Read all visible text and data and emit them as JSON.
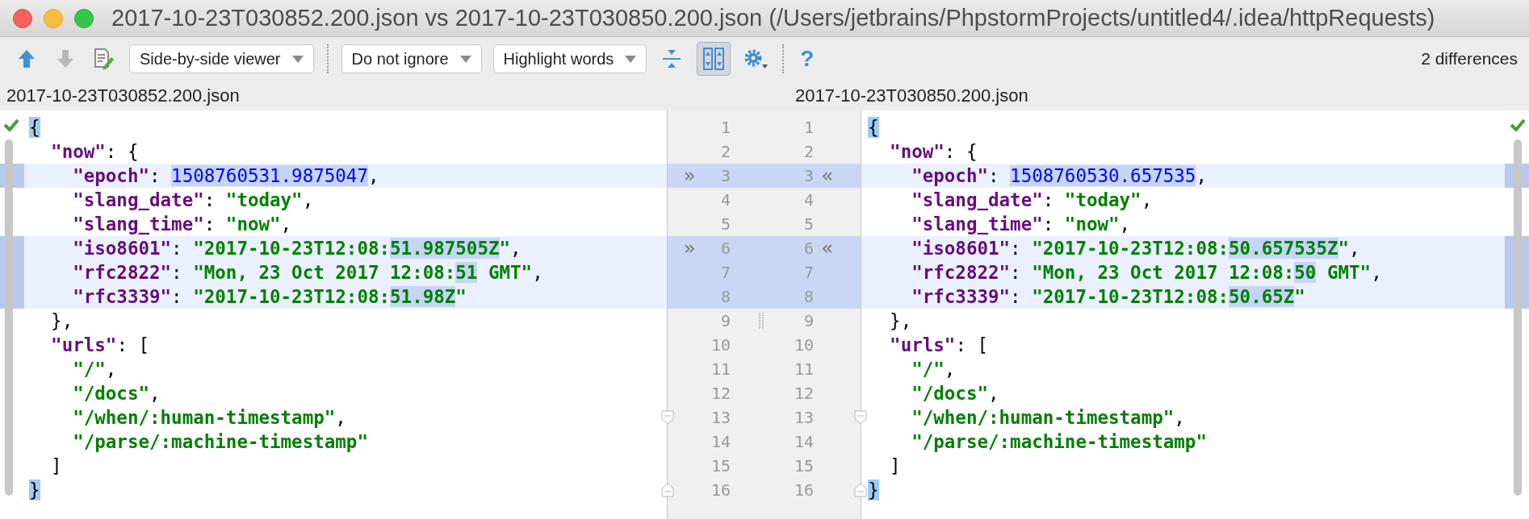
{
  "window": {
    "title": "2017-10-23T030852.200.json vs 2017-10-23T030850.200.json (/Users/jetbrains/PhpstormProjects/untitled4/.idea/httpRequests)"
  },
  "toolbar": {
    "items": [
      {
        "kind": "prev",
        "disabled": false
      },
      {
        "kind": "next",
        "disabled": true
      },
      {
        "kind": "edit",
        "disabled": false
      },
      {
        "kind": "dropdown",
        "label": "Side-by-side viewer"
      },
      {
        "kind": "separator"
      },
      {
        "kind": "dropdown",
        "label": "Do not ignore"
      },
      {
        "kind": "dropdown",
        "label": "Highlight words"
      },
      {
        "kind": "collapse",
        "selected": false
      },
      {
        "kind": "sync",
        "selected": true
      },
      {
        "kind": "gear"
      },
      {
        "kind": "separator"
      },
      {
        "kind": "help",
        "label": "?"
      }
    ],
    "differences": "2 differences"
  },
  "left": {
    "filename": "2017-10-23T030852.200.json",
    "lines": [
      {
        "number": "1",
        "changed": false,
        "tokens": [
          {
            "kind": "punct",
            "text": "{",
            "matched": true
          }
        ]
      },
      {
        "number": "2",
        "changed": false,
        "tokens": [
          {
            "kind": "key",
            "text": "  \"now\""
          },
          {
            "kind": "punct",
            "text": ": {"
          }
        ]
      },
      {
        "number": "3",
        "changed": true,
        "arrow": "»",
        "tokens": [
          {
            "kind": "key",
            "text": "    \"epoch\""
          },
          {
            "kind": "punct",
            "text": ": "
          },
          {
            "kind": "number",
            "text": "1508760531.9875047",
            "diff": true
          },
          {
            "kind": "punct",
            "text": ","
          }
        ]
      },
      {
        "number": "4",
        "changed": false,
        "tokens": [
          {
            "kind": "key",
            "text": "    \"slang_date\""
          },
          {
            "kind": "punct",
            "text": ": "
          },
          {
            "kind": "string",
            "text": "\"today\""
          },
          {
            "kind": "punct",
            "text": ","
          }
        ]
      },
      {
        "number": "5",
        "changed": false,
        "tokens": [
          {
            "kind": "key",
            "text": "    \"slang_time\""
          },
          {
            "kind": "punct",
            "text": ": "
          },
          {
            "kind": "string",
            "text": "\"now\""
          },
          {
            "kind": "punct",
            "text": ","
          }
        ]
      },
      {
        "number": "6",
        "changed": true,
        "arrow": "»",
        "tokens": [
          {
            "kind": "key",
            "text": "    \"iso8601\""
          },
          {
            "kind": "punct",
            "text": ": "
          },
          {
            "kind": "string",
            "text": "\"2017-10-23T12:08:"
          },
          {
            "kind": "string",
            "text": "51.987505Z",
            "diff": true
          },
          {
            "kind": "string",
            "text": "\""
          },
          {
            "kind": "punct",
            "text": ","
          }
        ]
      },
      {
        "number": "7",
        "changed": true,
        "tokens": [
          {
            "kind": "key",
            "text": "    \"rfc2822\""
          },
          {
            "kind": "punct",
            "text": ": "
          },
          {
            "kind": "string",
            "text": "\"Mon, 23 Oct 2017 12:08:"
          },
          {
            "kind": "string",
            "text": "51",
            "diff": true
          },
          {
            "kind": "string",
            "text": " GMT\""
          },
          {
            "kind": "punct",
            "text": ","
          }
        ]
      },
      {
        "number": "8",
        "changed": true,
        "tokens": [
          {
            "kind": "key",
            "text": "    \"rfc3339\""
          },
          {
            "kind": "punct",
            "text": ": "
          },
          {
            "kind": "string",
            "text": "\"2017-10-23T12:08:"
          },
          {
            "kind": "string",
            "text": "51.98Z",
            "diff": true
          },
          {
            "kind": "string",
            "text": "\""
          }
        ]
      },
      {
        "number": "9",
        "changed": false,
        "tokens": [
          {
            "kind": "punct",
            "text": "  },"
          }
        ]
      },
      {
        "number": "10",
        "changed": false,
        "tokens": [
          {
            "kind": "key",
            "text": "  \"urls\""
          },
          {
            "kind": "punct",
            "text": ": ["
          }
        ]
      },
      {
        "number": "11",
        "changed": false,
        "tokens": [
          {
            "kind": "string",
            "text": "    \"/\""
          },
          {
            "kind": "punct",
            "text": ","
          }
        ]
      },
      {
        "number": "12",
        "changed": false,
        "tokens": [
          {
            "kind": "string",
            "text": "    \"/docs\""
          },
          {
            "kind": "punct",
            "text": ","
          }
        ]
      },
      {
        "number": "13",
        "changed": false,
        "fold_start": true,
        "tokens": [
          {
            "kind": "string",
            "text": "    \"/when/:human-timestamp\""
          },
          {
            "kind": "punct",
            "text": ","
          }
        ]
      },
      {
        "number": "14",
        "changed": false,
        "tokens": [
          {
            "kind": "string",
            "text": "    \"/parse/:machine-timestamp\""
          }
        ]
      },
      {
        "number": "15",
        "changed": false,
        "tokens": [
          {
            "kind": "punct",
            "text": "  ]"
          }
        ]
      },
      {
        "number": "16",
        "changed": false,
        "fold_end": true,
        "tokens": [
          {
            "kind": "punct",
            "text": "}",
            "matched": true
          }
        ]
      }
    ]
  },
  "right": {
    "filename": "2017-10-23T030850.200.json",
    "lines": [
      {
        "number": "1",
        "changed": false,
        "tokens": [
          {
            "kind": "punct",
            "text": "{",
            "matched": true
          }
        ]
      },
      {
        "number": "2",
        "changed": false,
        "tokens": [
          {
            "kind": "key",
            "text": "  \"now\""
          },
          {
            "kind": "punct",
            "text": ": {"
          }
        ]
      },
      {
        "number": "3",
        "changed": true,
        "arrow": "«",
        "tokens": [
          {
            "kind": "key",
            "text": "    \"epoch\""
          },
          {
            "kind": "punct",
            "text": ": "
          },
          {
            "kind": "number",
            "text": "1508760530.657535",
            "diff": true
          },
          {
            "kind": "punct",
            "text": ","
          }
        ]
      },
      {
        "number": "4",
        "changed": false,
        "tokens": [
          {
            "kind": "key",
            "text": "    \"slang_date\""
          },
          {
            "kind": "punct",
            "text": ": "
          },
          {
            "kind": "string",
            "text": "\"today\""
          },
          {
            "kind": "punct",
            "text": ","
          }
        ]
      },
      {
        "number": "5",
        "changed": false,
        "tokens": [
          {
            "kind": "key",
            "text": "    \"slang_time\""
          },
          {
            "kind": "punct",
            "text": ": "
          },
          {
            "kind": "string",
            "text": "\"now\""
          },
          {
            "kind": "punct",
            "text": ","
          }
        ]
      },
      {
        "number": "6",
        "changed": true,
        "arrow": "«",
        "tokens": [
          {
            "kind": "key",
            "text": "    \"iso8601\""
          },
          {
            "kind": "punct",
            "text": ": "
          },
          {
            "kind": "string",
            "text": "\"2017-10-23T12:08:"
          },
          {
            "kind": "string",
            "text": "50.657535Z",
            "diff": true
          },
          {
            "kind": "string",
            "text": "\""
          },
          {
            "kind": "punct",
            "text": ","
          }
        ]
      },
      {
        "number": "7",
        "changed": true,
        "tokens": [
          {
            "kind": "key",
            "text": "    \"rfc2822\""
          },
          {
            "kind": "punct",
            "text": ": "
          },
          {
            "kind": "string",
            "text": "\"Mon, 23 Oct 2017 12:08:"
          },
          {
            "kind": "string",
            "text": "50",
            "diff": true
          },
          {
            "kind": "string",
            "text": " GMT\""
          },
          {
            "kind": "punct",
            "text": ","
          }
        ]
      },
      {
        "number": "8",
        "changed": true,
        "tokens": [
          {
            "kind": "key",
            "text": "    \"rfc3339\""
          },
          {
            "kind": "punct",
            "text": ": "
          },
          {
            "kind": "string",
            "text": "\"2017-10-23T12:08:"
          },
          {
            "kind": "string",
            "text": "50.65Z",
            "diff": true
          },
          {
            "kind": "string",
            "text": "\""
          }
        ]
      },
      {
        "number": "9",
        "changed": false,
        "tokens": [
          {
            "kind": "punct",
            "text": "  },"
          }
        ]
      },
      {
        "number": "10",
        "changed": false,
        "tokens": [
          {
            "kind": "key",
            "text": "  \"urls\""
          },
          {
            "kind": "punct",
            "text": ": ["
          }
        ]
      },
      {
        "number": "11",
        "changed": false,
        "tokens": [
          {
            "kind": "string",
            "text": "    \"/\""
          },
          {
            "kind": "punct",
            "text": ","
          }
        ]
      },
      {
        "number": "12",
        "changed": false,
        "tokens": [
          {
            "kind": "string",
            "text": "    \"/docs\""
          },
          {
            "kind": "punct",
            "text": ","
          }
        ]
      },
      {
        "number": "13",
        "changed": false,
        "fold_start": true,
        "tokens": [
          {
            "kind": "string",
            "text": "    \"/when/:human-timestamp\""
          },
          {
            "kind": "punct",
            "text": ","
          }
        ]
      },
      {
        "number": "14",
        "changed": false,
        "tokens": [
          {
            "kind": "string",
            "text": "    \"/parse/:machine-timestamp\""
          }
        ]
      },
      {
        "number": "15",
        "changed": false,
        "tokens": [
          {
            "kind": "punct",
            "text": "  ]"
          }
        ]
      },
      {
        "number": "16",
        "changed": false,
        "fold_end": true,
        "tokens": [
          {
            "kind": "punct",
            "text": "}",
            "matched": true
          }
        ]
      }
    ]
  }
}
